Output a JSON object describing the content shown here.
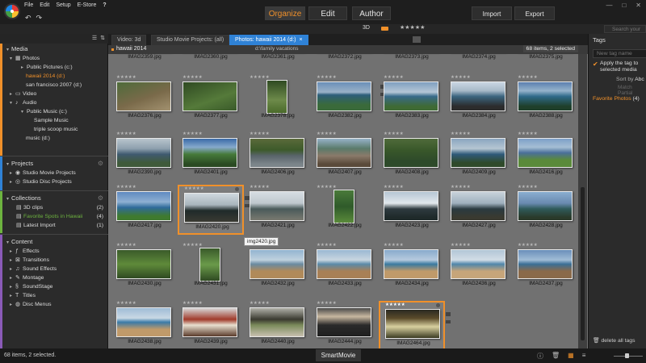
{
  "menu": [
    "File",
    "Edit",
    "Setup",
    "E-Store"
  ],
  "help_glyph": "?",
  "modes": {
    "organize": "Organize",
    "edit": "Edit",
    "author": "Author"
  },
  "actions": {
    "import": "Import",
    "export": "Export"
  },
  "window_controls": [
    "—",
    "□",
    "✕"
  ],
  "toolbar2": {
    "label_3d": "3D",
    "stars": "★★★★★",
    "search_placeholder": "Search your"
  },
  "left": {
    "media_title": "Media",
    "media_items": [
      {
        "label": "Photos"
      },
      {
        "label": "Public Pictures (c:)"
      },
      {
        "label": "hawaii 2014 (d:)"
      },
      {
        "label": "san francisco 2007 (d:)"
      },
      {
        "label": "Video"
      },
      {
        "label": "Audio"
      },
      {
        "label": "Public Music (c:)"
      },
      {
        "label": "Sample Music"
      },
      {
        "label": "triple scoop music"
      },
      {
        "label": "music (d:)"
      }
    ],
    "projects_title": "Projects",
    "projects_items": [
      {
        "label": "Studio Movie Projects"
      },
      {
        "label": "Studio Disc Projects"
      }
    ],
    "collections_title": "Collections",
    "collections_items": [
      {
        "label": "3D clips",
        "count": "(2)"
      },
      {
        "label": "Favorite Spots in Hawaii",
        "count": "(4)"
      },
      {
        "label": "Latest Import",
        "count": "(1)"
      }
    ],
    "content_title": "Content",
    "content_items": [
      {
        "label": "Effects"
      },
      {
        "label": "Transitions"
      },
      {
        "label": "Sound Effects"
      },
      {
        "label": "Montage"
      },
      {
        "label": "SoundStage"
      },
      {
        "label": "Titles"
      },
      {
        "label": "Disc Menus"
      }
    ]
  },
  "tabs": [
    {
      "label": "Video: 3d"
    },
    {
      "label": "Studio Movie Projects: (all)"
    },
    {
      "label": "Photos: hawaii 2014 (d:)"
    }
  ],
  "tab_close": "×",
  "breadcrumb": {
    "title": "hawaii 2014",
    "sub": "d:\\family vacations",
    "items_count": "68 items, 2 selected"
  },
  "tooltip": "img2420.jpg",
  "tiles": [
    {
      "name": "IMAG2359.jpg",
      "stars": "★★★★★",
      "rated": false,
      "thumb": "linear-gradient(#888,#777)"
    },
    {
      "name": "IMAG2360.jpg",
      "stars": "★★★★★",
      "rated": false,
      "thumb": "linear-gradient(#888,#777)"
    },
    {
      "name": "IMAG2361.jpg",
      "stars": "★★★★★",
      "rated": false,
      "thumb": "linear-gradient(#888,#777)"
    },
    {
      "name": "IMAG2372.jpg",
      "stars": "★★★★★",
      "rated": true,
      "thumb": "linear-gradient(#888,#777)"
    },
    {
      "name": "IMAG2373.jpg",
      "stars": "★★★★★",
      "rated": false,
      "thumb": "linear-gradient(#888,#777)"
    },
    {
      "name": "IMAG2374.jpg",
      "stars": "★★★★★",
      "rated": false,
      "thumb": "linear-gradient(#888,#777)"
    },
    {
      "name": "IMAG2375.jpg",
      "stars": "★★★★★",
      "rated": false,
      "thumb": "linear-gradient(#888,#777)"
    },
    {
      "name": "IMAG2376.jpg",
      "stars": "★★★★★",
      "rated": false,
      "thumb": "linear-gradient(160deg,#4e6b3a 0%,#7a6a4a 55%,#a39270 100%)"
    },
    {
      "name": "IMAG2377.jpg",
      "stars": "★★★★★",
      "rated": false,
      "thumb": "linear-gradient(160deg,#2f4a22,#557a3a 60%,#3a5a2a)"
    },
    {
      "name": "IMAG2378.jpg",
      "stars": "★★★★★",
      "rated": false,
      "thumb": "linear-gradient(#2f4a22,#6d8a4a 60%,#4a6a2a)"
    },
    {
      "name": "IMAG2382.jpg",
      "stars": "★★★★★",
      "rated": false,
      "thumb": "linear-gradient(#6a8fb8 0%,#9ab2c8 35%,#2d5e7a 45%,#3a6a3a 80%)"
    },
    {
      "name": "IMAG2383.jpg",
      "stars": "★★★★★",
      "rated": false,
      "thumb": "linear-gradient(#7f9fc0 0%,#b5c7d6 35%,#386a8a 50%,#3f6a34 85%)"
    },
    {
      "name": "IMAG2384.jpg",
      "stars": "★★★★★",
      "rated": false,
      "thumb": "linear-gradient(#c9d6e2 0%,#a7b9c8 30%,#3b6580 50%,#2c2c2c 85%)"
    },
    {
      "name": "IMAG2388.jpg",
      "stars": "★★★★★",
      "rated": false,
      "thumb": "linear-gradient(#5b80b0 0%,#96b3cc 30%,#2f6a8a 50%,#1f3f2a 85%)"
    },
    {
      "name": "IMAG2390.jpg",
      "stars": "★★★★★",
      "rated": false,
      "thumb": "linear-gradient(#b8c4cc 0%,#8ea0ae 35%,#3f5a70 55%,#3f5a3a 85%)"
    },
    {
      "name": "IMAG2401.jpg",
      "stars": "★★★★★",
      "rated": false,
      "thumb": "linear-gradient(#3a6aa8 0%,#86a9cc 30%,#467a3a 55%,#2a4a22 90%)"
    },
    {
      "name": "IMAG2406.jpg",
      "stars": "★★★★★",
      "rated": false,
      "thumb": "linear-gradient(#5a6a3a 0%,#3d5a2a 40%,#59646a 60%,#7c858a 90%)"
    },
    {
      "name": "IMAG2407.jpg",
      "stars": "★★★★★",
      "rated": false,
      "thumb": "linear-gradient(#96b2c8 0%,#5a7a6a 35%,#8a7a6a 60%,#5a4a3a 90%)"
    },
    {
      "name": "IMAG2408.jpg",
      "stars": "★★★★★",
      "rated": false,
      "thumb": "linear-gradient(#4f6a3a 0%,#39582a 40%,#2d4a2a 80%)"
    },
    {
      "name": "IMAG2409.jpg",
      "stars": "★★★★★",
      "rated": false,
      "thumb": "linear-gradient(#8aa6c0 0%,#b6c6d2 35%,#2f5a7a 55%,#2f4a2a 85%)"
    },
    {
      "name": "IMAG2416.jpg",
      "stars": "★★★★★",
      "rated": false,
      "thumb": "linear-gradient(#7da0c8 0%,#a5bed4 30%,#4a6f9a 50%,#5a8a3a 75%)"
    },
    {
      "name": "IMAG2417.jpg",
      "stars": "★★★★★",
      "rated": false,
      "thumb": "linear-gradient(#5f8ac0 0%,#8fb0d2 35%,#2f6a9a 55%,#3f7a2f 85%)"
    },
    {
      "name": "IMAG2420.jpg",
      "stars": "★★★★★",
      "rated": false,
      "thumb": "linear-gradient(#cfd8de 0%,#a8b4bc 40%,#1f2a2a 60%,#3a3a32 100%)"
    },
    {
      "name": "IMAG2421.jpg",
      "stars": "★★★★★",
      "rated": false,
      "thumb": "linear-gradient(#d6dde2 0%,#bfc8ce 40%,#4a5a5a 60%,#7a7a70 100%)"
    },
    {
      "name": "IMAG2422.jpg",
      "stars": "★★★★★",
      "rated": false,
      "thumb": "linear-gradient(#4a7a3a 0%,#2f5a2a 50%,#5a8a3a 100%)"
    },
    {
      "name": "IMAG2423.jpg",
      "stars": "★★★★★",
      "rated": false,
      "thumb": "linear-gradient(#b6c6d4 0%,#e2e8ec 40%,#2e3a3f 60%,#1f2a2a 90%)"
    },
    {
      "name": "IMAG2427.jpg",
      "stars": "★★★★★",
      "rated": false,
      "thumb": "linear-gradient(#c8d2da 0%,#9fb0be 40%,#2a3a40 60%,#3a3a30 90%)"
    },
    {
      "name": "IMAG2428.jpg",
      "stars": "★★★★★",
      "rated": false,
      "thumb": "linear-gradient(#8aaed0 0%,#6a8ab0 40%,#2f5a5a 60%,#2a3a2a 90%)"
    },
    {
      "name": "IMAG2430.jpg",
      "stars": "★★★★★",
      "rated": false,
      "thumb": "linear-gradient(#3a5a2a 0%,#5f8a3a 50%,#2f4a22 100%)"
    },
    {
      "name": "IMAG2431.jpg",
      "stars": "★★★★★",
      "rated": false,
      "thumb": "linear-gradient(#3a5a2a 0%,#6a9a4a 50%,#2f4a22 100%)"
    },
    {
      "name": "IMAG2432.jpg",
      "stars": "★★★★★",
      "rated": false,
      "thumb": "linear-gradient(#93b4d0 0%,#bfd1de 35%,#6a8aa0 50%,#b08a5a 75%)"
    },
    {
      "name": "IMAG2433.jpg",
      "stars": "★★★★★",
      "rated": false,
      "thumb": "linear-gradient(#9ab8d2 0%,#c8d6e0 35%,#5a8aa8 50%,#a88056 75%)"
    },
    {
      "name": "IMAG2434.jpg",
      "stars": "★★★★★",
      "rated": false,
      "thumb": "linear-gradient(#88aacc 0%,#b6cade 35%,#3a7aa0 50%,#c09a6a 75%)"
    },
    {
      "name": "IMAG2436.jpg",
      "stars": "★★★★★",
      "rated": false,
      "thumb": "linear-gradient(#b2c6d6 0%,#d2dde6 35%,#4f86aa 50%,#c6a57a 75%)"
    },
    {
      "name": "IMAG2437.jpg",
      "stars": "★★★★★",
      "rated": false,
      "thumb": "linear-gradient(#6a8fba 0%,#a0bcd6 35%,#3a6f96 50%,#8a6a4a 75%)"
    },
    {
      "name": "IMAG2438.jpg",
      "stars": "★★★★★",
      "rated": false,
      "thumb": "linear-gradient(#9fbcd6 0%,#c9d8e4 35%,#3a7aa8 50%,#c09a6a 75%)"
    },
    {
      "name": "IMAG2439.jpg",
      "stars": "★★★★★",
      "rated": false,
      "thumb": "linear-gradient(#d8d8d8 0%,#a03a2a 40%,#e8e0d0 60%,#5a3a2a 100%)"
    },
    {
      "name": "IMAG2440.jpg",
      "stars": "★★★★★",
      "rated": false,
      "thumb": "linear-gradient(#b0b0a8 0%,#3a3a30 40%,#7a8a5a 60%,#c8c0b0 100%)"
    },
    {
      "name": "IMAG2444.jpg",
      "stars": "★★★★★",
      "rated": false,
      "thumb": "linear-gradient(#4a4a4a 0%,#c8b8a0 30%,#2a2a2a 60%,#1f1f1f 100%)"
    },
    {
      "name": "IMAG2464.jpg",
      "stars": "★★★★★",
      "rated": true,
      "thumb": "linear-gradient(#2a2a22 0%,#5a4a2a 30%,#d8d0a0 60%,#3a3a22 100%)"
    }
  ],
  "right": {
    "title": "Tags",
    "tag_placeholder": "New tag name",
    "apply_label": "Apply the tag to selected media",
    "sort_by": "Sort by",
    "sort_value": "Abc",
    "match_partial": "Match Partial",
    "favorite_tag": "Favorite Photos",
    "favorite_count": "(4)",
    "delete_all": "delete all tags"
  },
  "status": {
    "text": "68 items, 2 selected.",
    "smartmovie": "SmartMovie"
  },
  "colors": {
    "accent": "#f0902a",
    "tab_active": "#2f82d6",
    "grid_bg": "#717171",
    "green": "#6db33f"
  }
}
